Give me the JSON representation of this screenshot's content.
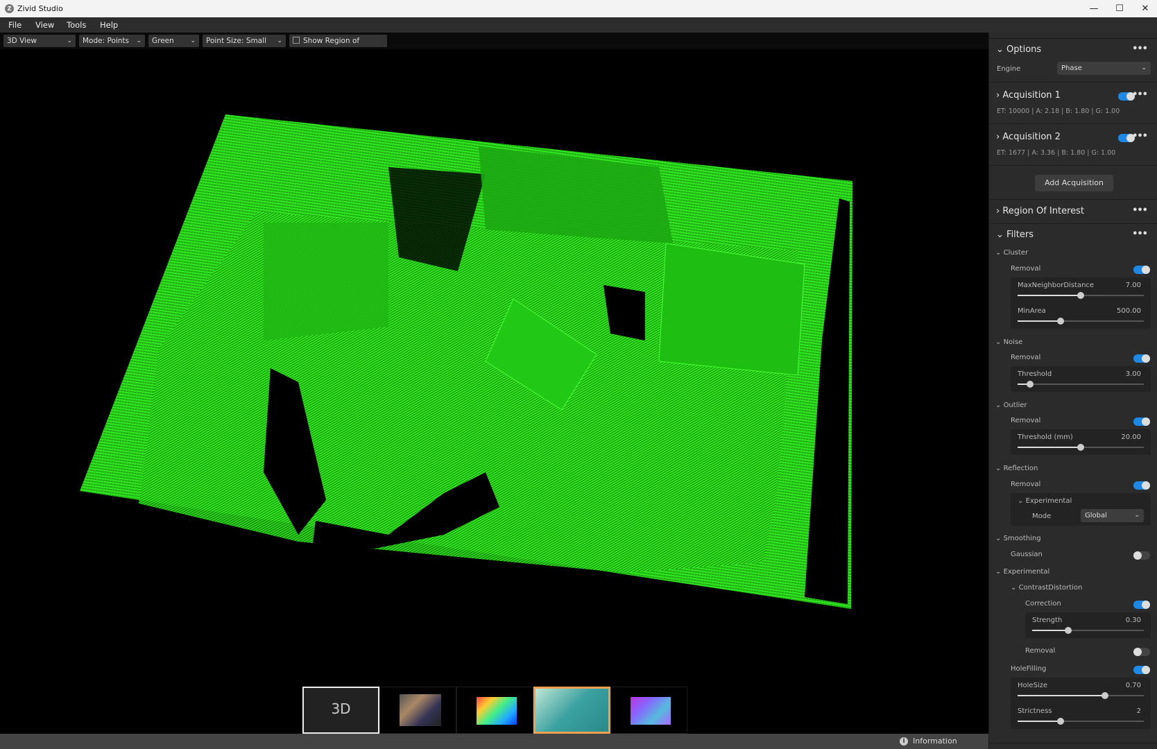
{
  "window": {
    "title": "Zivid Studio",
    "minimize": "—",
    "maximize": "☐",
    "close": "✕"
  },
  "menu": [
    "File",
    "View",
    "Tools",
    "Help"
  ],
  "toolbar": {
    "view": "3D View",
    "mode": "Mode: Points",
    "color": "Green",
    "point_size": "Point Size: Small",
    "roi_checkbox": "Show Region of Interest",
    "chevron": "⌄"
  },
  "panel": {
    "options": {
      "title": "Options",
      "engine_label": "Engine",
      "engine_value": "Phase"
    },
    "acquisitions": [
      {
        "title": "Acquisition 1",
        "info": "ET: 10000  |  A: 2.18  |  B: 1.80  |  G: 1.00",
        "enabled": true
      },
      {
        "title": "Acquisition 2",
        "info": "ET: 1677  |  A: 3.36  |  B: 1.80  |  G: 1.00",
        "enabled": true
      }
    ],
    "add_acquisition": "Add Acquisition",
    "roi": "Region Of Interest",
    "filters": {
      "title": "Filters",
      "cluster": {
        "label": "Cluster",
        "removal": "Removal",
        "removal_on": true,
        "max_neighbor": {
          "label": "MaxNeighborDistance",
          "value": "7.00",
          "fraction": 0.5
        },
        "min_area": {
          "label": "MinArea",
          "value": "500.00",
          "fraction": 0.34
        }
      },
      "noise": {
        "label": "Noise",
        "removal": "Removal",
        "removal_on": true,
        "threshold": {
          "label": "Threshold",
          "value": "3.00",
          "fraction": 0.1
        }
      },
      "outlier": {
        "label": "Outlier",
        "removal": "Removal",
        "removal_on": true,
        "threshold": {
          "label": "Threshold (mm)",
          "value": "20.00",
          "fraction": 0.5
        }
      },
      "reflection": {
        "label": "Reflection",
        "removal": "Removal",
        "removal_on": true,
        "experimental": "Experimental",
        "mode_label": "Mode",
        "mode_value": "Global"
      },
      "smoothing": {
        "label": "Smoothing",
        "gaussian": "Gaussian",
        "gaussian_on": false
      },
      "experimental": {
        "label": "Experimental",
        "contrast": "ContrastDistortion",
        "correction": "Correction",
        "correction_on": true,
        "strength": {
          "label": "Strength",
          "value": "0.30",
          "fraction": 0.32
        },
        "removal": "Removal",
        "removal_on": false,
        "hole_filling": "HoleFilling",
        "hole_filling_on": true,
        "hole_size": {
          "label": "HoleSize",
          "value": "0.70",
          "fraction": 0.69
        },
        "strictness": {
          "label": "Strictness",
          "value": "2",
          "fraction": 0.34
        }
      }
    }
  },
  "thumbnails": {
    "three_d": "3D",
    "selected": 3
  },
  "status": {
    "information": "Information"
  },
  "colors": {
    "accent": "#1e88e5",
    "cloud": "#22e01a",
    "selected_thumb": "#f0a050"
  }
}
